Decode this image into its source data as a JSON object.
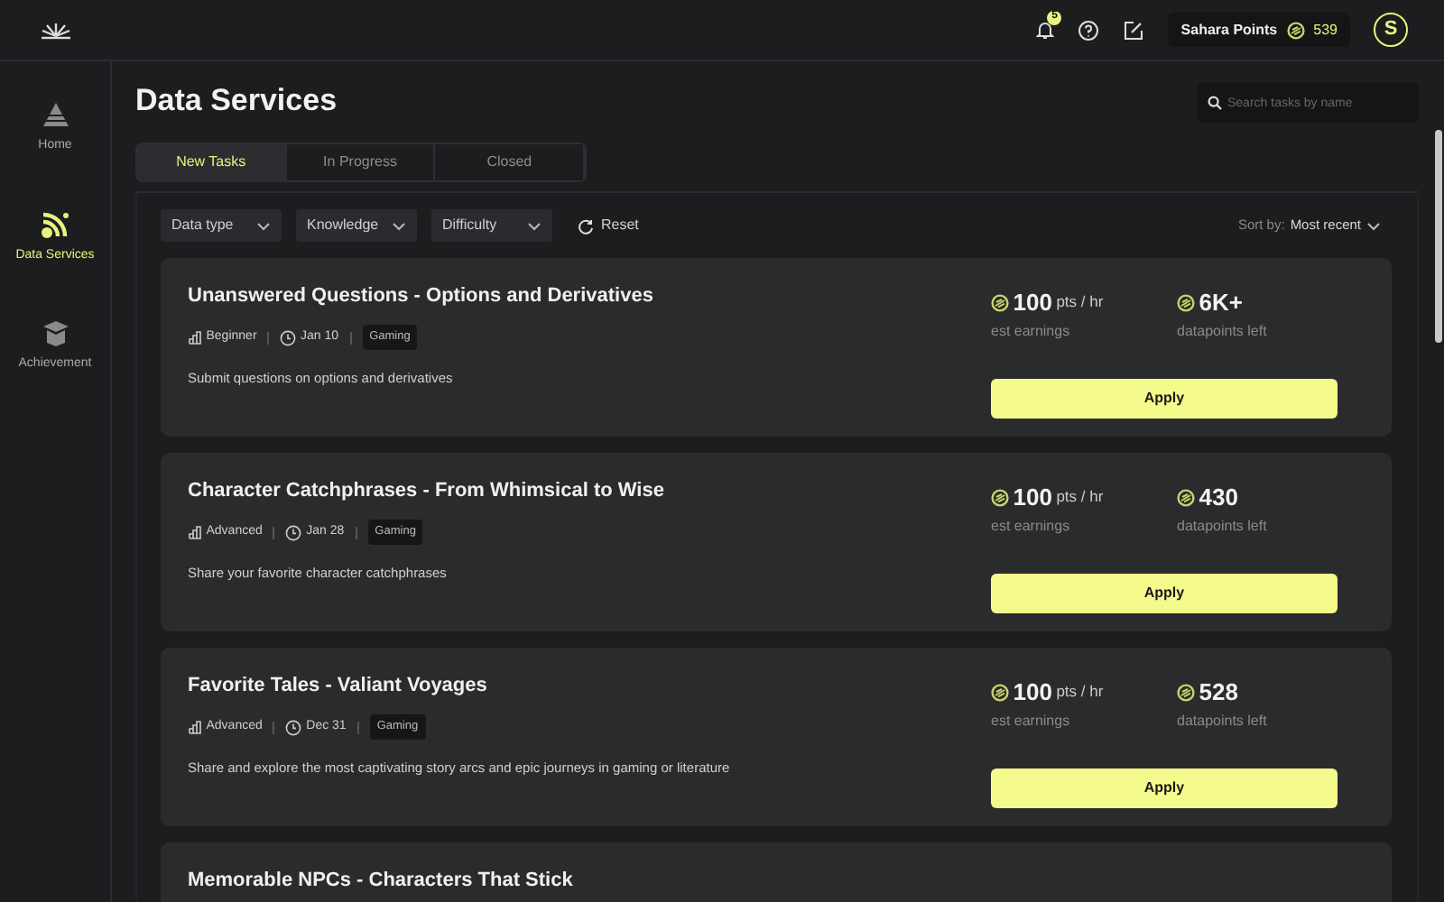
{
  "header": {
    "notification_count": "5",
    "points_label": "Sahara Points",
    "points_value": "539",
    "avatar_letter": "S"
  },
  "sidebar": {
    "items": [
      {
        "label": "Home",
        "selected": false
      },
      {
        "label": "Data Services",
        "selected": true
      },
      {
        "label": "Achievement",
        "selected": false
      }
    ]
  },
  "page_title": "Data Services",
  "search": {
    "placeholder": "Search tasks by name"
  },
  "tabs": [
    {
      "label": "New Tasks",
      "selected": true
    },
    {
      "label": "In Progress",
      "selected": false
    },
    {
      "label": "Closed",
      "selected": false
    }
  ],
  "filters": [
    "Data type",
    "Knowledge",
    "Difficulty"
  ],
  "reset": "Reset",
  "sort": {
    "label": "Sort by:",
    "value": "Most recent"
  },
  "tasks": [
    {
      "title": "Unanswered Questions - Options and Derivatives",
      "level": "Beginner",
      "date": "Jan 10",
      "tag": "Gaming",
      "description": "Submit questions on options and derivatives",
      "rate": "100",
      "rate_unit": "pts / hr",
      "rate_label": "est earnings",
      "remaining": "6K+",
      "remaining_label": "datapoints left",
      "button": "Apply"
    },
    {
      "title": "Character Catchphrases - From Whimsical to Wise",
      "level": "Advanced",
      "date": "Jan 28",
      "tag": "Gaming",
      "description": "Share your favorite character catchphrases",
      "rate": "100",
      "rate_unit": "pts / hr",
      "rate_label": "est earnings",
      "remaining": "430",
      "remaining_label": "datapoints left",
      "button": "Apply"
    },
    {
      "title": "Favorite Tales - Valiant Voyages",
      "level": "Advanced",
      "date": "Dec 31",
      "tag": "Gaming",
      "description": "Share and explore the most captivating story arcs and epic journeys in gaming or literature",
      "rate": "100",
      "rate_unit": "pts / hr",
      "rate_label": "est earnings",
      "remaining": "528",
      "remaining_label": "datapoints left",
      "button": "Apply"
    },
    {
      "title": "Memorable NPCs - Characters That Stick"
    }
  ]
}
